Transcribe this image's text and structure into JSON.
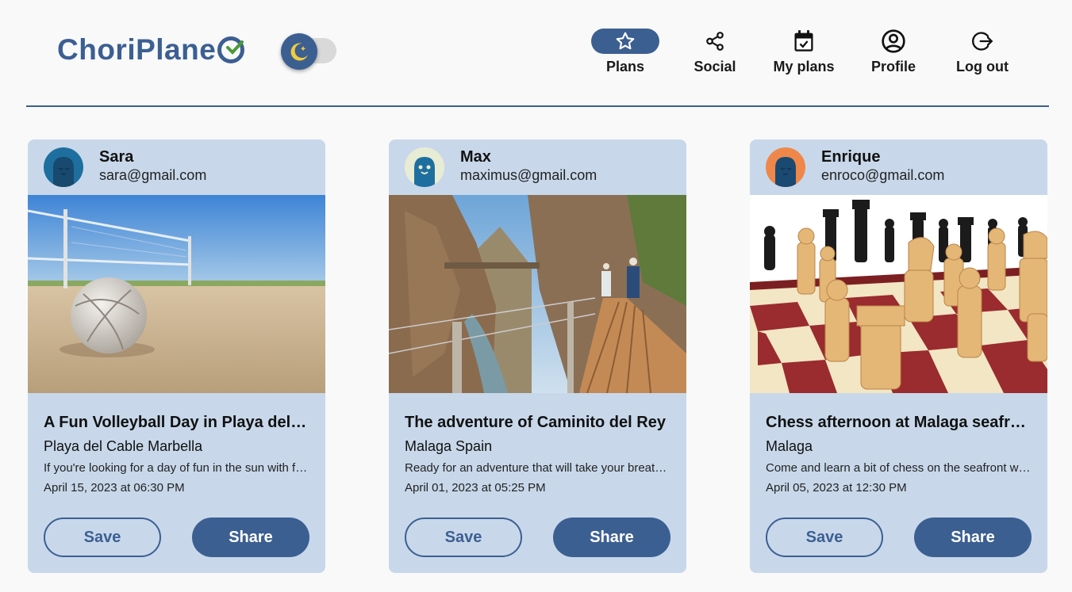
{
  "app": {
    "logo_text": "ChoriPlane"
  },
  "nav": {
    "plans": "Plans",
    "social": "Social",
    "my_plans": "My plans",
    "profile": "Profile",
    "logout": "Log out"
  },
  "colors": {
    "accent": "#3c5f92",
    "card_bg": "#c8d8ea",
    "page_bg": "#f9f9fa"
  },
  "plans": [
    {
      "user": "Sara",
      "email": "sara@gmail.com",
      "title": "A Fun Volleyball Day in Playa del Cable Marbella",
      "place": "Playa del Cable Marbella",
      "description": "If you're looking for a day of fun in the sun with friends",
      "date": "April 15, 2023 at 06:30 PM",
      "save": "Save",
      "share": "Share"
    },
    {
      "user": "Max",
      "email": "maximus@gmail.com",
      "title": "The adventure of Caminito del Rey",
      "place": "Malaga Spain",
      "description": "Ready for an adventure that will take your breath away",
      "date": "April 01, 2023 at 05:25 PM",
      "save": "Save",
      "share": "Share"
    },
    {
      "user": "Enrique",
      "email": "enroco@gmail.com",
      "title": "Chess afternoon at Malaga seafront",
      "place": "Malaga",
      "description": "Come and learn a bit of chess on the seafront with us",
      "date": "April 05, 2023 at 12:30 PM",
      "save": "Save",
      "share": "Share"
    }
  ]
}
